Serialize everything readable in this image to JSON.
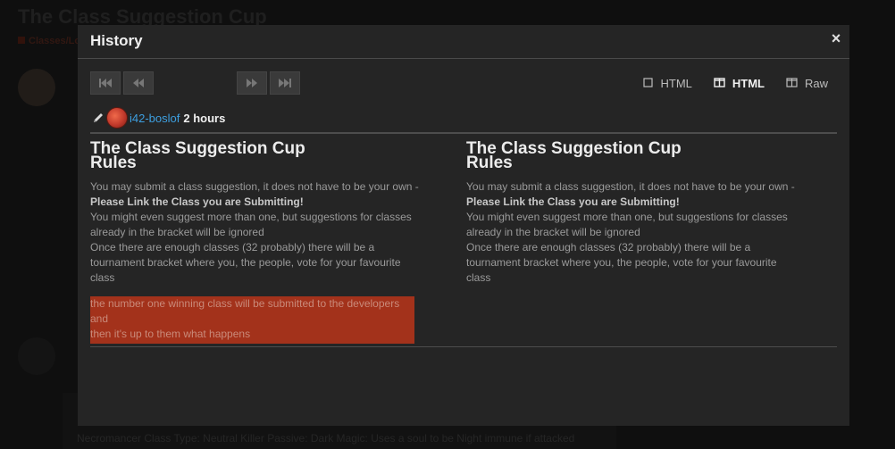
{
  "background": {
    "page_title": "The Class Suggestion Cup",
    "category": "Classes/Lo",
    "bottom_text": "Necromancer Class Type: Neutral Killer Passive: Dark Magic: Uses a soul to be Night immune if attacked"
  },
  "modal": {
    "title": "History",
    "close_label": "×"
  },
  "nav": {
    "first": "first-revision",
    "prev": "previous-revision",
    "next": "next-revision",
    "last": "last-revision"
  },
  "view_options": [
    {
      "label": "HTML",
      "icon": "square-icon",
      "active": false
    },
    {
      "label": "HTML",
      "icon": "split-columns-icon",
      "active": true
    },
    {
      "label": "Raw",
      "icon": "split-columns-icon",
      "active": false
    }
  ],
  "revision": {
    "user": "i42-boslof",
    "time": "2 hours"
  },
  "left": {
    "title_line1": "The Class Suggestion Cup",
    "title_line2": "Rules",
    "line1": "You may submit a class suggestion, it does not have to be your own -",
    "line2": "Please Link the Class you are Submitting!",
    "line3": "You might even suggest more than one, but suggestions for classes",
    "line4": "already in the bracket will be ignored",
    "line5": "Once there are enough classes (32 probably) there will be a",
    "line6": "tournament bracket where you, the people, vote for your favourite",
    "line7": "class",
    "removed1": "the number one winning class will be submitted to the developers and",
    "removed2": "then it's up to them what happens"
  },
  "right": {
    "title_line1": "The Class Suggestion Cup",
    "title_line2": "Rules",
    "line1": "You may submit a class suggestion, it does not have to be your own -",
    "line2": "Please Link the Class you are Submitting!",
    "line3": "You might even suggest more than one, but suggestions for classes",
    "line4": "already in the bracket will be ignored",
    "line5": "Once there are enough classes (32 probably) there will be a",
    "line6": "tournament bracket where you, the people, vote for your favourite",
    "line7": "class"
  },
  "colors": {
    "removed_highlight": "#a3321b",
    "link": "#3d9fe0"
  }
}
